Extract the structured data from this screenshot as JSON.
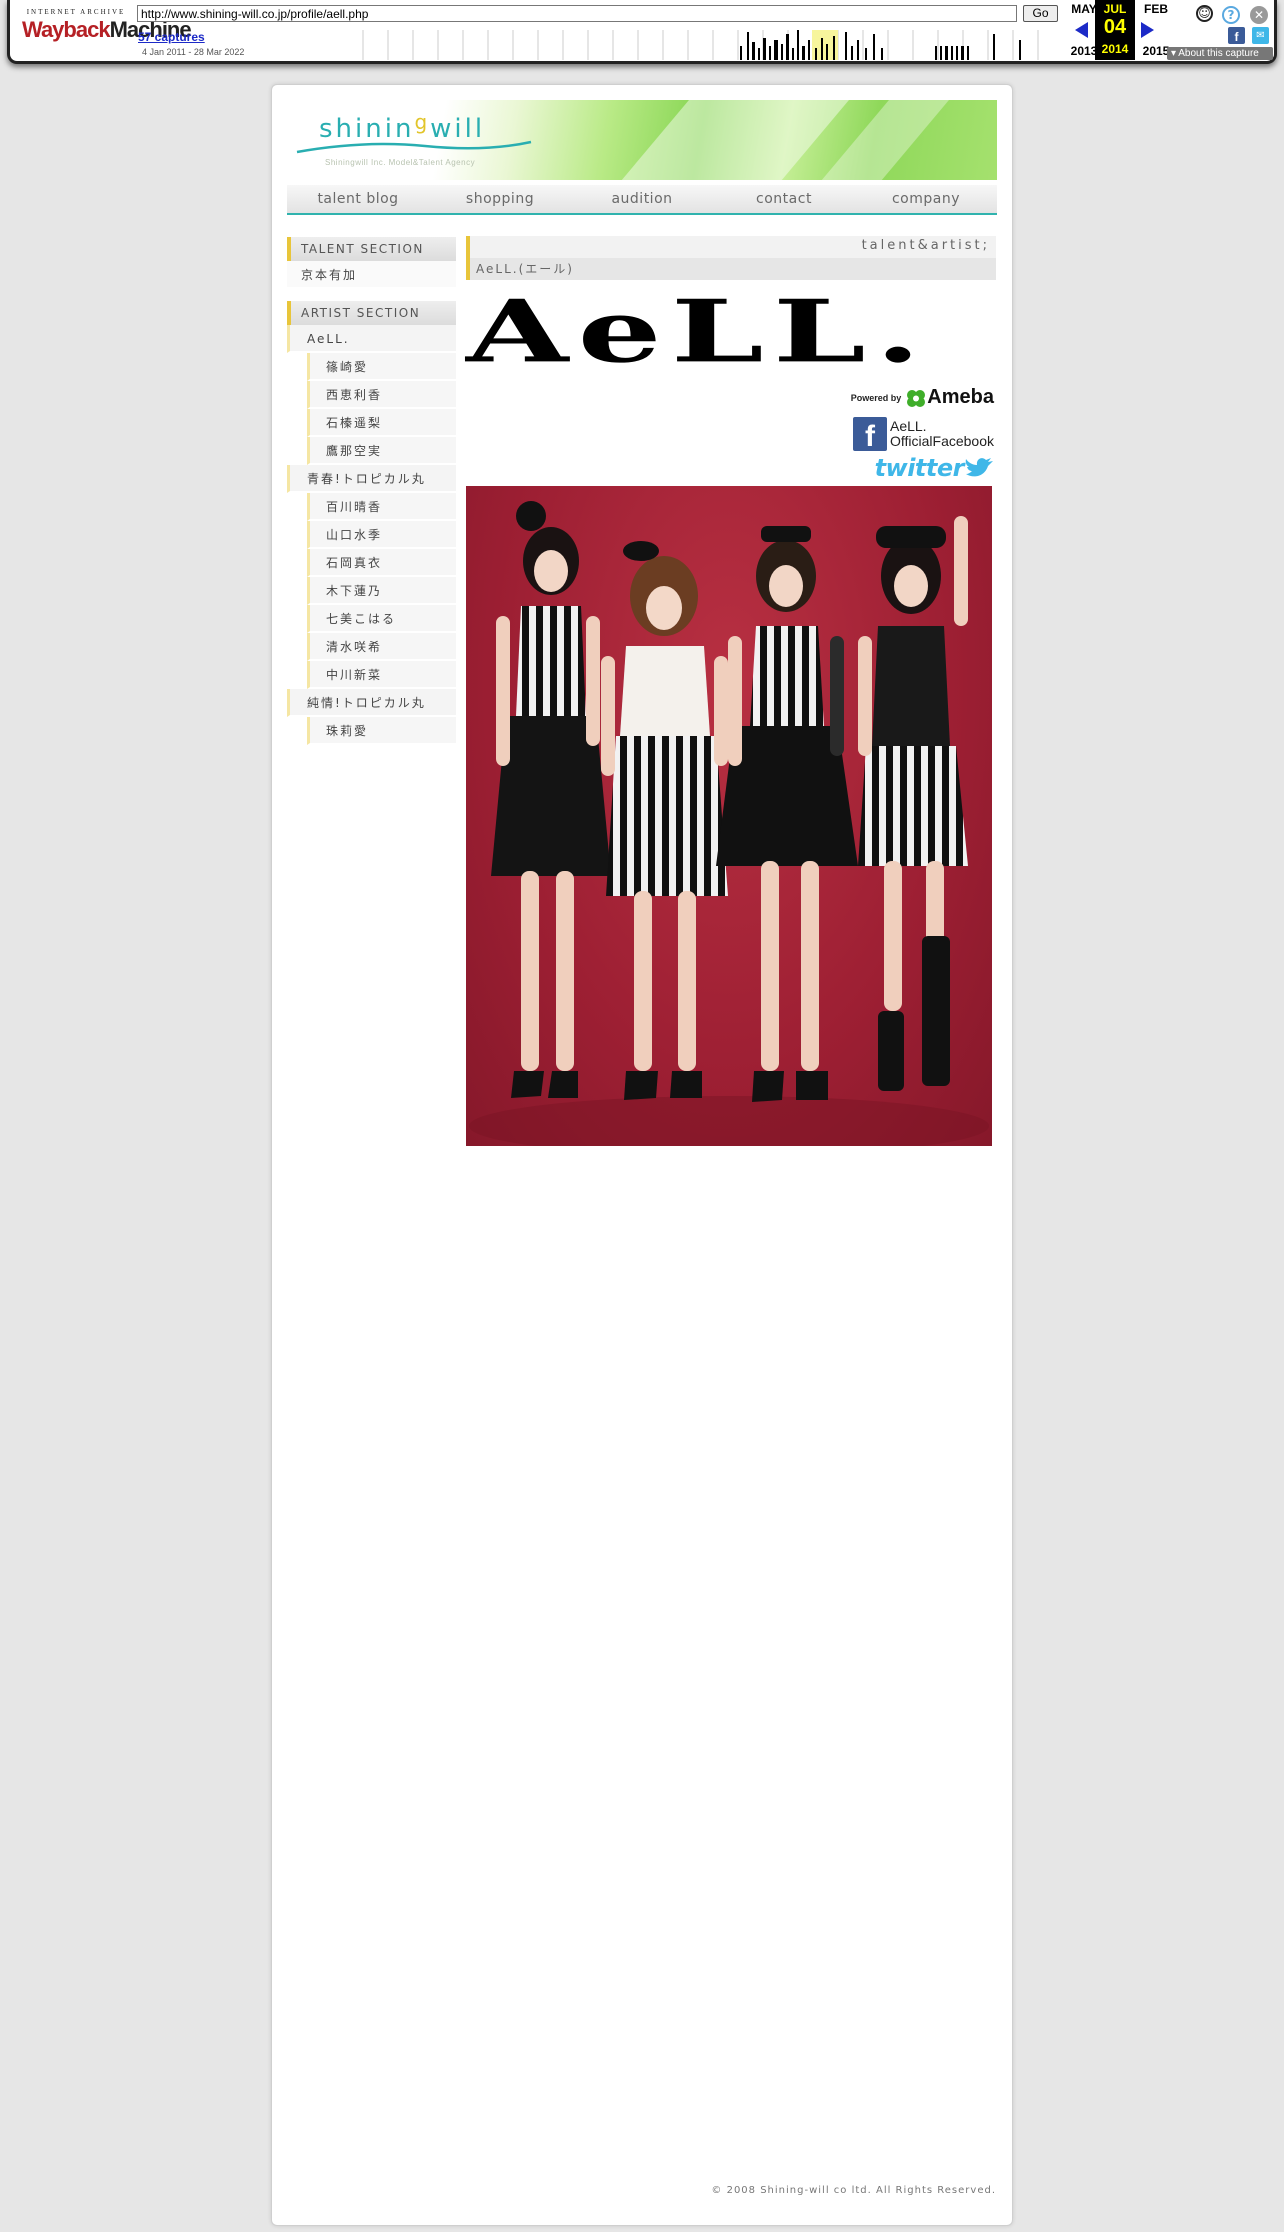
{
  "wayback": {
    "logo_top": "INTERNET ARCHIVE",
    "logo_way": "Wayback",
    "logo_machine": "Machine",
    "url": "http://www.shining-will.co.jp/profile/aell.php",
    "go_label": "Go",
    "captures": "57 captures",
    "range": "4 Jan 2011 - 28 Mar 2022",
    "prev_month": "MAY",
    "prev_year": "2013",
    "cur_month": "JUL",
    "cur_day": "04",
    "cur_year": "2014",
    "next_month": "FEB",
    "next_year": "2015",
    "about_label": "About this capture"
  },
  "site": {
    "logo": {
      "pre": "shinin",
      "g": "g",
      "post": "will"
    },
    "logo_sub": "Shiningwill Inc. Model&Talent Agency",
    "nav": [
      {
        "label": "talent blog"
      },
      {
        "label": "shopping"
      },
      {
        "label": "audition"
      },
      {
        "label": "contact"
      },
      {
        "label": "company"
      }
    ],
    "sidebar": {
      "talent_heading": "TALENT SECTION",
      "talent_items": [
        "京本有加"
      ],
      "artist_heading": "ARTIST SECTION",
      "groups": [
        {
          "name": "AeLL.",
          "members": [
            "篠崎愛",
            "西恵利香",
            "石榛遥梨",
            "鷹那空実"
          ]
        },
        {
          "name": "青春!トロピカル丸",
          "members": [
            "百川晴香",
            "山口水季",
            "石岡真衣",
            "木下蓮乃",
            "七美こはる",
            "清水咲希",
            "中川新菜"
          ]
        },
        {
          "name": "純情!トロピカル丸",
          "members": [
            "珠莉愛"
          ]
        }
      ]
    },
    "main": {
      "crumb": "talent&artist;",
      "title": "AeLL.(エール)",
      "big_title": "AeLL.",
      "powered_by": "Powered by",
      "ameba": "Ameba",
      "fb_line1": "AeLL.",
      "fb_line2": "OfficialFacebook",
      "twitter": "twitter"
    },
    "footer": "© 2008 Shining-will co ltd. All Rights Reserved."
  }
}
